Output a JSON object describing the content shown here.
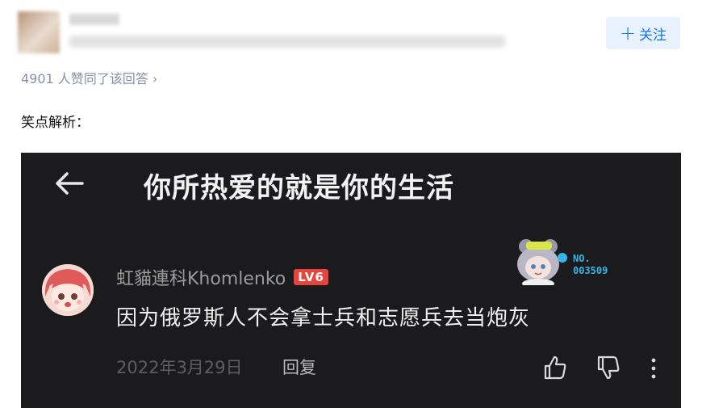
{
  "header": {
    "follow_label": "关注"
  },
  "answer": {
    "likes_text": "4901 人赞同了该回答 ›",
    "intro_text": "笑点解析："
  },
  "screenshot": {
    "page_title": "你所热爱的就是你的生活",
    "comment": {
      "username": "虹貓連科Khomlenko",
      "level": "LV6",
      "text": "因为俄罗斯人不会拿士兵和志愿兵去当炮灰",
      "date": "2022年3月29日",
      "reply_label": "回复"
    },
    "fan_badge": {
      "line1": "NO.",
      "line2": "003509"
    },
    "colors": {
      "background": "#1b1b1d",
      "level_badge": "#e8443c",
      "fan_number": "#35b6e8"
    }
  },
  "colors": {
    "accent": "#1772f6",
    "muted": "#8590a6"
  }
}
